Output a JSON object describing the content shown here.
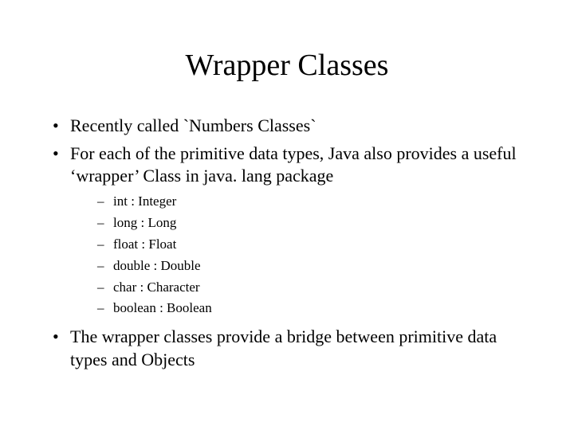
{
  "title": "Wrapper Classes",
  "bullets": {
    "b1": "Recently called `Numbers Classes`",
    "b2": "For each of the primitive data types, Java also provides a useful ‘wrapper’ Class  in  java. lang  package",
    "sub": {
      "s1": "int : Integer",
      "s2": "long : Long",
      "s3": "float : Float",
      "s4": "double : Double",
      "s5": "char : Character",
      "s6": "boolean : Boolean"
    },
    "b3": "The wrapper classes provide a bridge between primitive data types and Objects"
  }
}
